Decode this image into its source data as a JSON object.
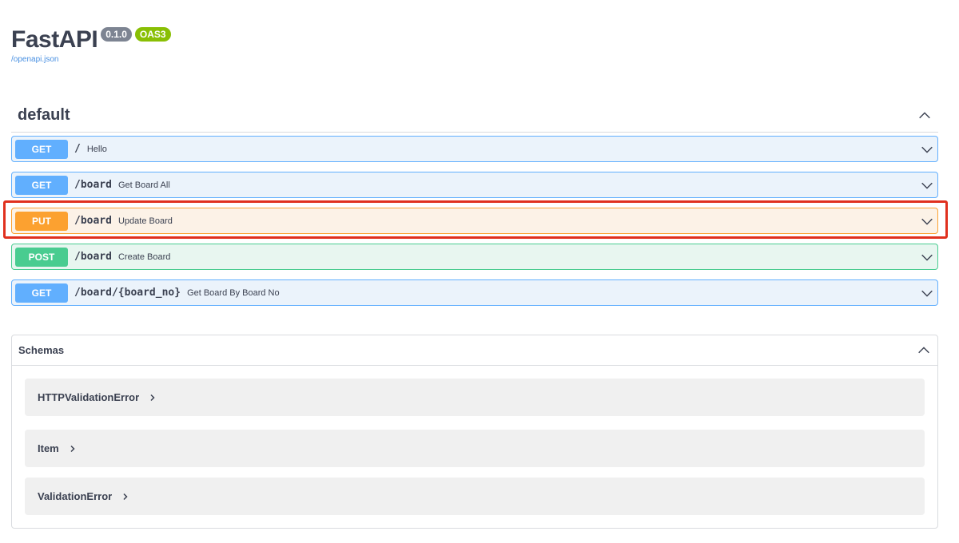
{
  "header": {
    "title": "FastAPI",
    "version": "0.1.0",
    "oas": "OAS3",
    "spec_link": "/openapi.json"
  },
  "section": {
    "title": "default"
  },
  "operations": [
    {
      "method": "GET",
      "path": "/",
      "summary": "Hello"
    },
    {
      "method": "GET",
      "path": "/board",
      "summary": "Get Board All"
    },
    {
      "method": "PUT",
      "path": "/board",
      "summary": "Update Board"
    },
    {
      "method": "POST",
      "path": "/board",
      "summary": "Create Board"
    },
    {
      "method": "GET",
      "path": "/board/{board_no}",
      "summary": "Get Board By Board No"
    }
  ],
  "schemas": {
    "title": "Schemas",
    "models": [
      "HTTPValidationError",
      "Item",
      "ValidationError"
    ]
  },
  "colors": {
    "get": "#61affe",
    "put": "#fca130",
    "post": "#49cc90",
    "highlight": "#e0301e"
  },
  "icons": {
    "collapse": "chevron-up-icon",
    "expand": "chevron-down-icon",
    "model_expand": "chevron-right-icon"
  }
}
